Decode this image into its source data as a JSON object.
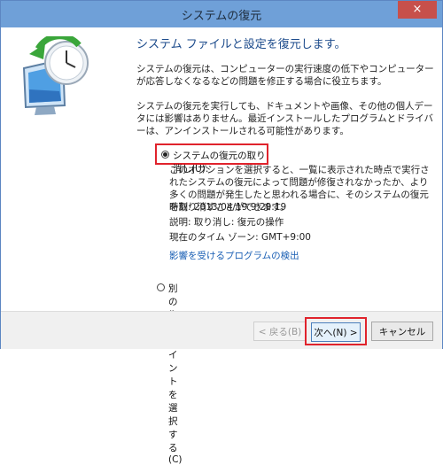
{
  "window": {
    "title": "システムの復元",
    "close_glyph": "×"
  },
  "sidebar": {
    "icon": "system-restore-icon"
  },
  "content": {
    "heading": "システム ファイルと設定を復元します。",
    "paragraph1": "システムの復元は、コンピューターの実行速度の低下やコンピューターが応答しなくなるなどの問題を修正する場合に役立ちます。",
    "paragraph2": "システムの復元を実行しても、ドキュメントや画像、その他の個人データには影響はありません。最近インストールしたプログラムとドライバーは、アンインストールされる可能性があります。",
    "option_undo": {
      "label": "システムの復元の取り消し(U):",
      "selected": true,
      "description": "このオプションを選択すると、一覧に表示された時点で実行されたシステムの復元によって問題が修復されなかったか、より多くの問題が発生したと思われる場合に、そのシステムの復元を取り消すことができます。",
      "time": "時刻: 2013/04/19 9:29:19",
      "explanation": "説明: 取り消し: 復元の操作",
      "timezone": "現在のタイム ゾーン: GMT+9:00",
      "link": "影響を受けるプログラムの検出"
    },
    "option_other": {
      "label": "別の復元ポイントを選択する(C)",
      "selected": false
    }
  },
  "footer": {
    "back": "< 戻る(B)",
    "next": "次へ(N) >",
    "cancel": "キャンセル"
  },
  "colors": {
    "titlebar": "#6fa0d8",
    "highlight": "#e0232c",
    "heading": "#1b4a8b",
    "link": "#1a5fb4"
  }
}
